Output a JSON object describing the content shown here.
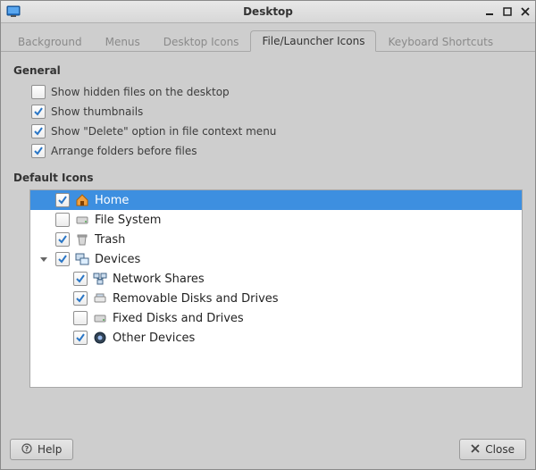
{
  "window": {
    "title": "Desktop"
  },
  "tabs": [
    {
      "label": "Background"
    },
    {
      "label": "Menus"
    },
    {
      "label": "Desktop Icons"
    },
    {
      "label": "File/Launcher Icons"
    },
    {
      "label": "Keyboard Shortcuts"
    }
  ],
  "active_tab_index": 3,
  "sections": {
    "general": {
      "title": "General",
      "options": [
        {
          "label": "Show hidden files on the desktop",
          "checked": false
        },
        {
          "label": "Show thumbnails",
          "checked": true
        },
        {
          "label": "Show \"Delete\" option in file context menu",
          "checked": true
        },
        {
          "label": "Arrange folders before files",
          "checked": true
        }
      ]
    },
    "default_icons": {
      "title": "Default Icons",
      "tree": [
        {
          "indent": 0,
          "expander": "none",
          "checked": true,
          "icon": "home-icon",
          "label": "Home",
          "selected": true
        },
        {
          "indent": 0,
          "expander": "none",
          "checked": false,
          "icon": "drive-icon",
          "label": "File System",
          "selected": false
        },
        {
          "indent": 0,
          "expander": "none",
          "checked": true,
          "icon": "trash-icon",
          "label": "Trash",
          "selected": false
        },
        {
          "indent": 0,
          "expander": "open",
          "checked": true,
          "icon": "devices-icon",
          "label": "Devices",
          "selected": false
        },
        {
          "indent": 1,
          "expander": "none",
          "checked": true,
          "icon": "network-icon",
          "label": "Network Shares",
          "selected": false
        },
        {
          "indent": 1,
          "expander": "none",
          "checked": true,
          "icon": "removable-icon",
          "label": "Removable Disks and Drives",
          "selected": false
        },
        {
          "indent": 1,
          "expander": "none",
          "checked": false,
          "icon": "drive-icon",
          "label": "Fixed Disks and Drives",
          "selected": false
        },
        {
          "indent": 1,
          "expander": "none",
          "checked": true,
          "icon": "other-icon",
          "label": "Other Devices",
          "selected": false
        }
      ]
    }
  },
  "footer": {
    "help_label": "Help",
    "close_label": "Close"
  }
}
